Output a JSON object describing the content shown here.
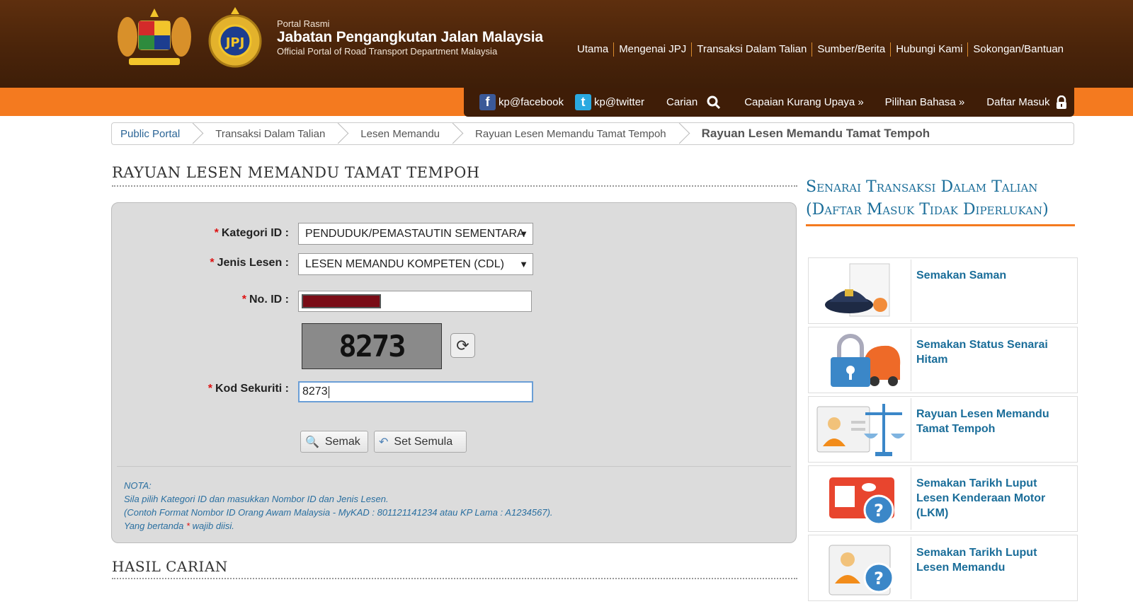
{
  "header": {
    "portal_small": "Portal Rasmi",
    "portal_title": "Jabatan Pengangkutan Jalan Malaysia",
    "portal_subtitle": "Official Portal of Road Transport Department Malaysia",
    "nav": [
      "Utama",
      "Mengenai JPJ",
      "Transaksi Dalam Talian",
      "Sumber/Berita",
      "Hubungi Kami",
      "Sokongan/Bantuan"
    ]
  },
  "toolbar": {
    "facebook": "kp@facebook",
    "twitter": "kp@twitter",
    "search": "Carian",
    "accessibility": "Capaian Kurang Upaya »",
    "language": "Pilihan Bahasa »",
    "login": "Daftar Masuk"
  },
  "breadcrumb": [
    "Public Portal",
    "Transaksi Dalam Talian",
    "Lesen Memandu",
    "Rayuan Lesen Memandu Tamat Tempoh",
    "Rayuan Lesen Memandu Tamat Tempoh"
  ],
  "page_title": "RAYUAN LESEN MEMANDU TAMAT TEMPOH",
  "form": {
    "kategori_label": "Kategori ID :",
    "kategori_value": "PENDUDUK/PEMASTAUTIN SEMENTARA",
    "jenis_label": "Jenis Lesen :",
    "jenis_value": "LESEN MEMANDU KOMPETEN (CDL)",
    "noid_label": "No. ID :",
    "captcha_text": "8273",
    "kod_label": "Kod Sekuriti :",
    "kod_value": "8273",
    "btn_check": "Semak",
    "btn_reset": "Set Semula",
    "required_mark": "*"
  },
  "note": {
    "heading": "NOTA:",
    "line1": "Sila pilih Kategori ID dan masukkan Nombor ID dan Jenis Lesen.",
    "line2": "(Contoh Format Nombor ID Orang Awam Malaysia - MyKAD : 801121141234 atau KP Lama : A1234567).",
    "line3a": "Yang bertanda",
    "line3b": "wajib diisi."
  },
  "results_title": "HASIL CARIAN",
  "sidebar": {
    "title_line1": "Senarai Transaksi Dalam Talian",
    "title_line2": "(Daftar Masuk Tidak Diperlukan)",
    "items": [
      {
        "label": "Semakan Saman",
        "icon": "police-cap-document-icon"
      },
      {
        "label": "Semakan Status Senarai Hitam",
        "icon": "padlock-car-icon"
      },
      {
        "label": "Rayuan Lesen Memandu Tamat Tempoh",
        "icon": "license-scale-icon"
      },
      {
        "label": "Semakan Tarikh Luput Lesen Kenderaan Motor (LKM)",
        "icon": "card-question-icon"
      },
      {
        "label": "Semakan Tarikh Luput Lesen Memandu",
        "icon": "license-question-icon"
      }
    ]
  }
}
